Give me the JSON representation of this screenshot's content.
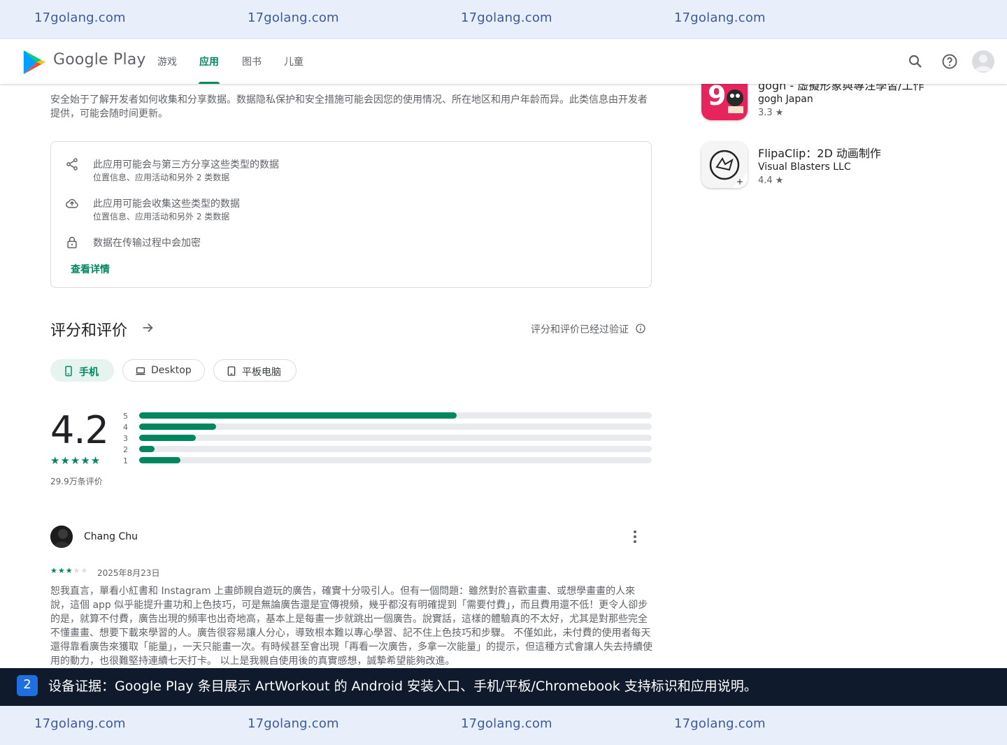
{
  "watermark": {
    "text": "17golang.com"
  },
  "header": {
    "brand": "Google Play",
    "tabs": [
      {
        "label": "游戏"
      },
      {
        "label": "应用"
      },
      {
        "label": "图书"
      },
      {
        "label": "儿童"
      }
    ],
    "active_tab": "应用",
    "accent_color": "#01875f"
  },
  "data_safety": {
    "intro": "安全始于了解开发者如何收集和分享数据。数据隐私保护和安全措施可能会因您的使用情况、所在地区和用户年龄而异。此类信息由开发者提供，可能会随时间更新。",
    "rows": [
      {
        "icon": "share-icon",
        "title": "此应用可能会与第三方分享这些类型的数据",
        "subtitle": "位置信息、应用活动和另外 2 类数据"
      },
      {
        "icon": "cloud-upload-icon",
        "title": "此应用可能会收集这些类型的数据",
        "subtitle": "位置信息、应用活动和另外 2 类数据"
      },
      {
        "icon": "lock-icon",
        "title": "数据在传输过程中会加密"
      }
    ],
    "details_link": "查看详情"
  },
  "ratings": {
    "title": "评分和评价",
    "verified": "评分和评价已经过验证",
    "chips": [
      {
        "label": "手机",
        "icon": "phone-icon",
        "active": true
      },
      {
        "label": "Desktop",
        "icon": "laptop-icon",
        "active": false
      },
      {
        "label": "平板电脑",
        "icon": "tablet-icon",
        "active": false
      }
    ],
    "score": "4.2",
    "stars_glyph": "★★★★★",
    "count": "29.9万条评价",
    "distribution": [
      {
        "label": "5",
        "fraction": 0.62
      },
      {
        "label": "4",
        "fraction": 0.15
      },
      {
        "label": "3",
        "fraction": 0.11
      },
      {
        "label": "2",
        "fraction": 0.03
      },
      {
        "label": "1",
        "fraction": 0.08
      }
    ]
  },
  "review": {
    "author": "Chang Chu",
    "rating": 3,
    "stars_on": "★★★",
    "stars_off": "★★",
    "date": "2025年8月23日",
    "body": "恕我直言，單看小紅書和 Instagram 上畫師親自遊玩的廣告，確實十分吸引人。但有一個問題：雖然對於喜歡畫畫、或想學畫畫的人來說，這個 app 似乎能提升畫功和上色技巧，可是無論廣告還是宣傳視頻，幾乎都沒有明確提到「需要付費」，而且費用還不低！更令人卻步的是，就算不付費，廣告出現的頻率也出奇地高，基本上是每畫一步就跳出一個廣告。說實話，這樣的體驗真的不太好，尤其是對那些完全不懂畫畫、想要下載來學習的人。廣告很容易讓人分心，導致根本難以專心學習、記不住上色技巧和步驟。 不僅如此，未付費的使用者每天還得靠看廣告來獲取「能量」，一天只能畫一次。有時候甚至會出現「再看一次廣告，多拿一次能量」的提示，但這種方式會讓人失去持續使用的動力，也很難堅持連續七天打卡。 以上是我親自使用後的真實感想，誠摯希望能夠改進。"
  },
  "similar_apps": [
    {
      "title": "gogh - 虛擬形象與專注學習/工作",
      "developer": "gogh Japan",
      "rating": "3.3 ★"
    },
    {
      "title": "FlipaClip：2D 动画制作",
      "developer": "Visual Blasters LLC",
      "rating": "4.4 ★"
    }
  ],
  "caption": {
    "number": "2",
    "text": "设备证据：Google Play 条目展示 ArtWorkout 的 Android 安装入口、手机/平板/Chromebook 支持标识和应用说明。"
  }
}
